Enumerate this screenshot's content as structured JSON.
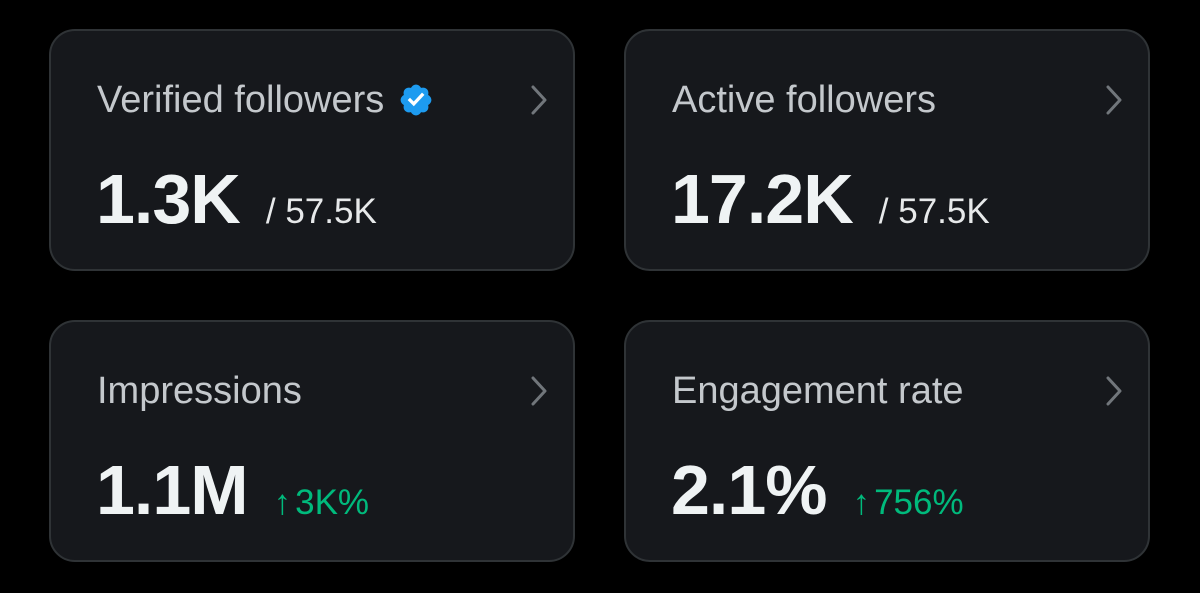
{
  "cards": [
    {
      "title": "Verified followers",
      "verified_icon": "verified-badge-icon",
      "value": "1.3K",
      "total": "/ 57.5K",
      "chevron_icon": "chevron-right-icon"
    },
    {
      "title": "Active followers",
      "value": "17.2K",
      "total": "/ 57.5K",
      "chevron_icon": "chevron-right-icon"
    },
    {
      "title": "Impressions",
      "value": "1.1M",
      "delta_arrow": "↑",
      "delta": "3K%",
      "chevron_icon": "chevron-right-icon"
    },
    {
      "title": "Engagement rate",
      "value": "2.1%",
      "delta_arrow": "↑",
      "delta": "756%",
      "chevron_icon": "chevron-right-icon"
    }
  ],
  "colors": {
    "background": "#000000",
    "card_background": "#16181c",
    "card_border": "#2f3336",
    "title_text": "#c4c8cc",
    "value_text": "#eff3f4",
    "positive_delta": "#00ba7c",
    "verified_badge": "#1d9bf0"
  }
}
